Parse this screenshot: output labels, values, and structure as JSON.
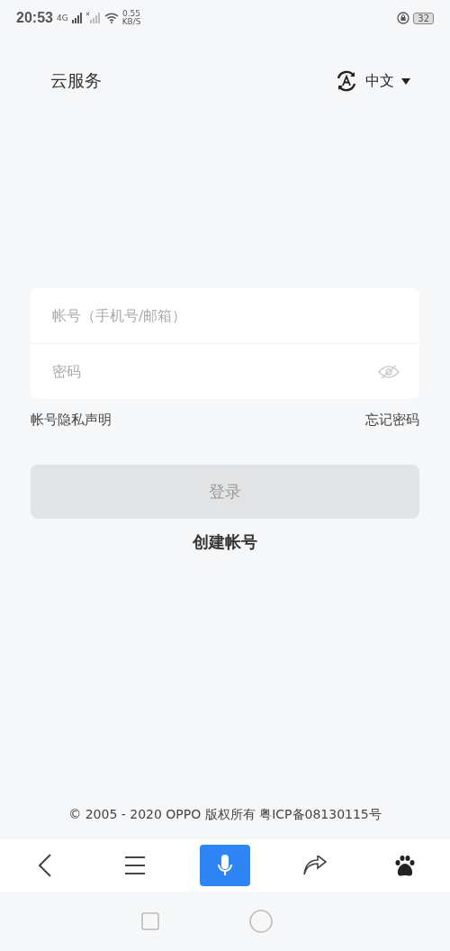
{
  "status_bar": {
    "time": "20:53",
    "network": "4G",
    "speed_value": "0.55",
    "speed_unit": "KB/S",
    "battery": "32"
  },
  "header": {
    "title": "云服务",
    "language": "中文"
  },
  "form": {
    "fields": [
      {
        "kind": "text",
        "placeholder": "帐号（手机号/邮箱）"
      },
      {
        "kind": "password",
        "placeholder": "密码"
      }
    ]
  },
  "links": {
    "privacy": "帐号隐私声明",
    "forgot": "忘记密码"
  },
  "login_button": {
    "label": "登录",
    "disabled": true
  },
  "create_account": "创建帐号",
  "footer": "© 2005 - 2020 OPPO 版权所有 粤ICP备08130115号"
}
